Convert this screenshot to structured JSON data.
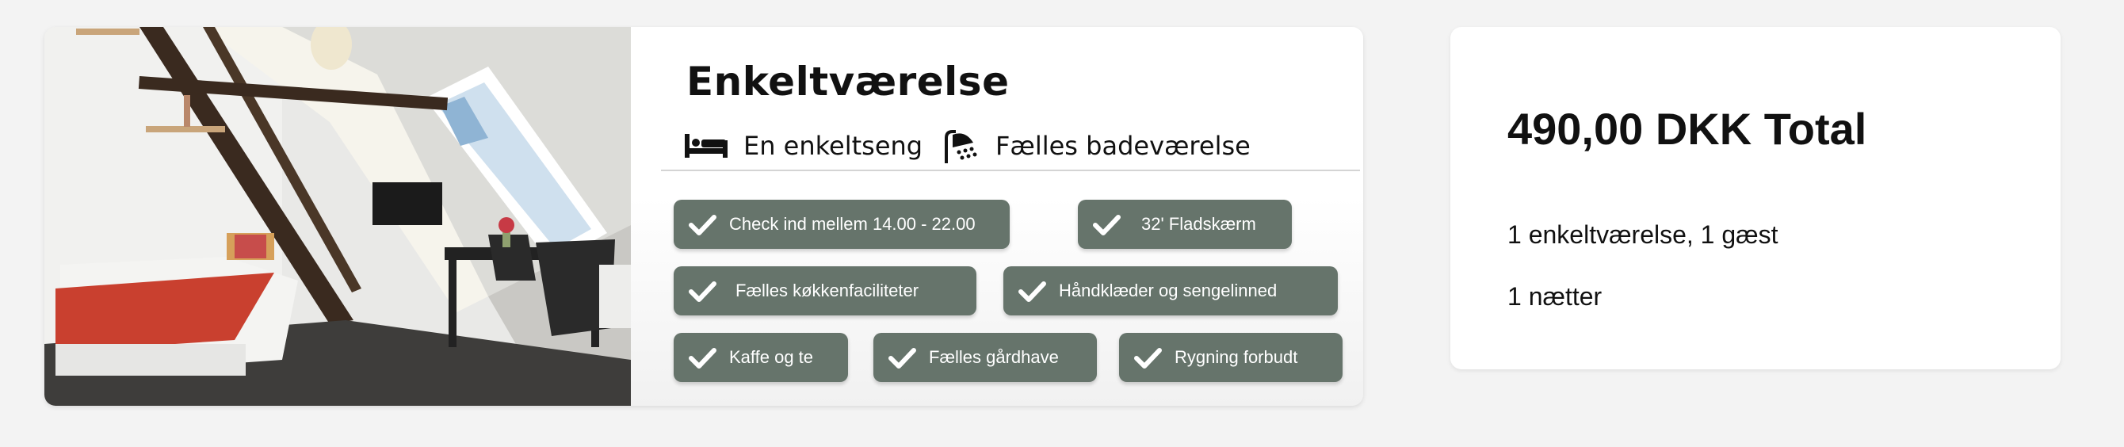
{
  "room": {
    "title": "Enkeltværelse",
    "features": [
      {
        "icon": "bed-icon",
        "label": "En enkeltseng"
      },
      {
        "icon": "shower-icon",
        "label": "Fælles badeværelse"
      }
    ],
    "amenities": [
      {
        "icon": "checkmark-icon",
        "label": "Check ind mellem 14.00 - 22.00"
      },
      {
        "icon": "checkmark-icon",
        "label": "32' Fladskærm"
      },
      {
        "icon": "checkmark-icon",
        "label": "Fælles køkkenfaciliteter"
      },
      {
        "icon": "checkmark-icon",
        "label": "Håndklæder og sengelinned"
      },
      {
        "icon": "checkmark-icon",
        "label": "Kaffe og te"
      },
      {
        "icon": "checkmark-icon",
        "label": "Fælles gårdhave"
      },
      {
        "icon": "checkmark-icon",
        "label": "Rygning forbudt"
      }
    ]
  },
  "summary": {
    "total": "490,00 DKK Total",
    "rooms_guests": "1 enkeltværelse, 1 gæst",
    "nights": "1 nætter"
  },
  "colors": {
    "pill_bg": "#66746b",
    "pill_text": "#ffffff",
    "page_bg": "#f3f3f3",
    "card_bg": "#ffffff"
  }
}
